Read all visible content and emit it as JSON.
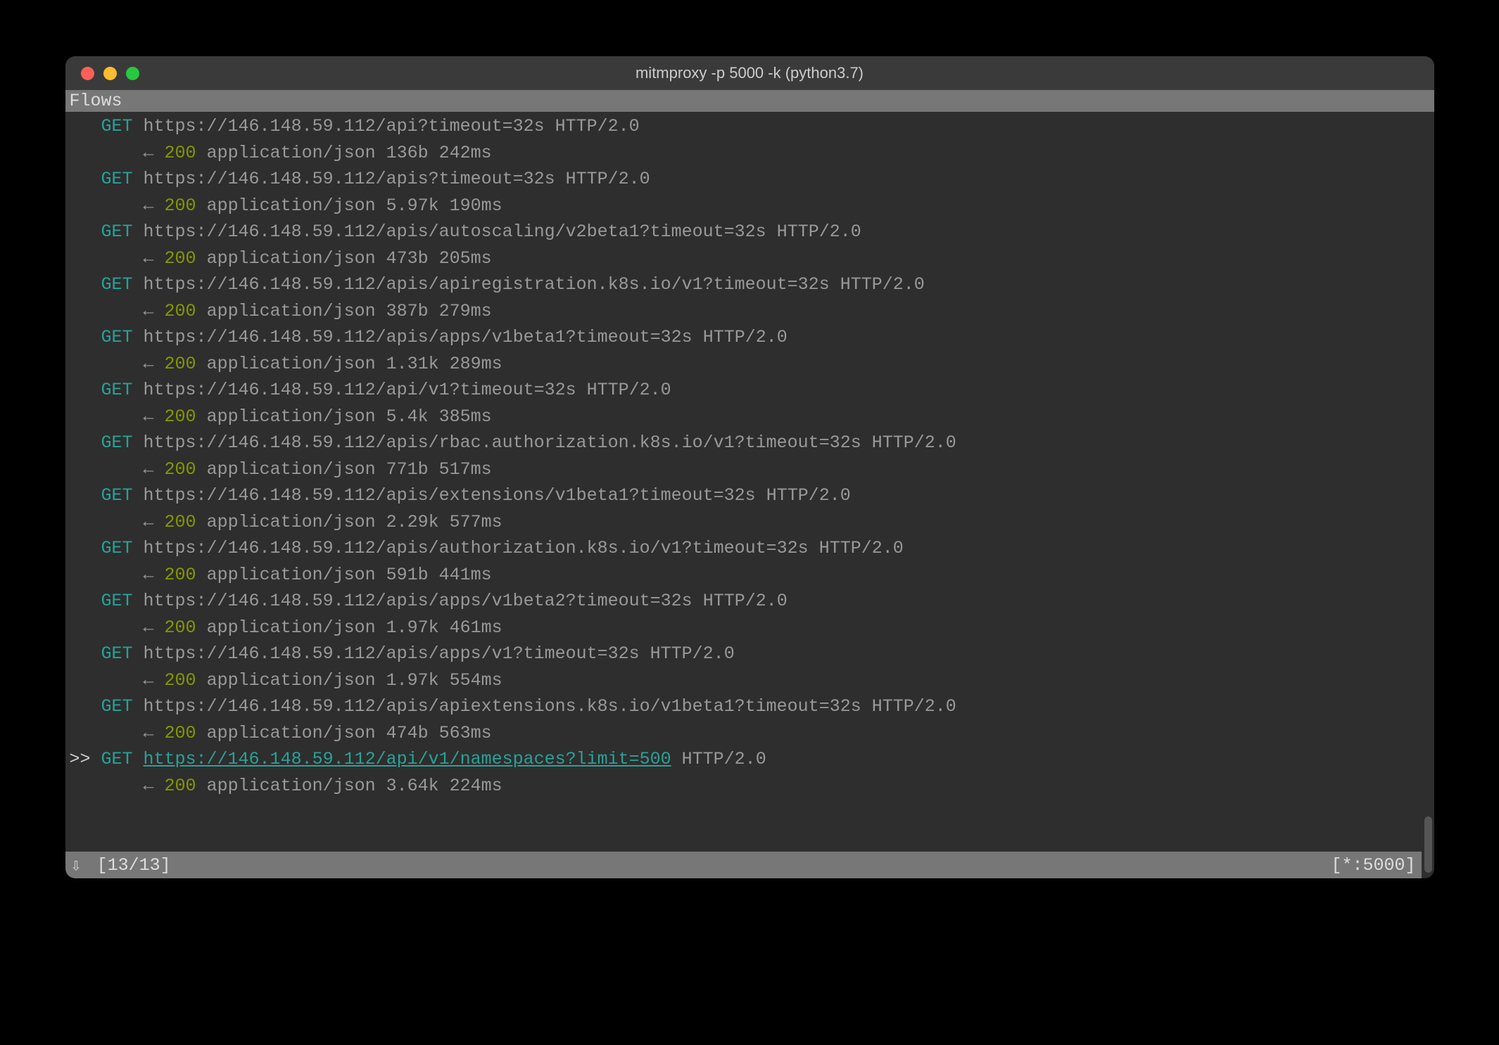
{
  "window": {
    "title": "mitmproxy -p 5000 -k (python3.7)"
  },
  "header": "Flows",
  "flows": [
    {
      "selected": false,
      "method": "GET",
      "url": "https://146.148.59.112/api?timeout=32s",
      "proto": "HTTP/2.0",
      "arrow": "←",
      "status": "200",
      "ctype": "application/json",
      "size": "136b",
      "time": "242ms"
    },
    {
      "selected": false,
      "method": "GET",
      "url": "https://146.148.59.112/apis?timeout=32s",
      "proto": "HTTP/2.0",
      "arrow": "←",
      "status": "200",
      "ctype": "application/json",
      "size": "5.97k",
      "time": "190ms"
    },
    {
      "selected": false,
      "method": "GET",
      "url": "https://146.148.59.112/apis/autoscaling/v2beta1?timeout=32s",
      "proto": "HTTP/2.0",
      "arrow": "←",
      "status": "200",
      "ctype": "application/json",
      "size": "473b",
      "time": "205ms"
    },
    {
      "selected": false,
      "method": "GET",
      "url": "https://146.148.59.112/apis/apiregistration.k8s.io/v1?timeout=32s",
      "proto": "HTTP/2.0",
      "arrow": "←",
      "status": "200",
      "ctype": "application/json",
      "size": "387b",
      "time": "279ms"
    },
    {
      "selected": false,
      "method": "GET",
      "url": "https://146.148.59.112/apis/apps/v1beta1?timeout=32s",
      "proto": "HTTP/2.0",
      "arrow": "←",
      "status": "200",
      "ctype": "application/json",
      "size": "1.31k",
      "time": "289ms"
    },
    {
      "selected": false,
      "method": "GET",
      "url": "https://146.148.59.112/api/v1?timeout=32s",
      "proto": "HTTP/2.0",
      "arrow": "←",
      "status": "200",
      "ctype": "application/json",
      "size": "5.4k",
      "time": "385ms"
    },
    {
      "selected": false,
      "method": "GET",
      "url": "https://146.148.59.112/apis/rbac.authorization.k8s.io/v1?timeout=32s",
      "proto": "HTTP/2.0",
      "arrow": "←",
      "status": "200",
      "ctype": "application/json",
      "size": "771b",
      "time": "517ms"
    },
    {
      "selected": false,
      "method": "GET",
      "url": "https://146.148.59.112/apis/extensions/v1beta1?timeout=32s",
      "proto": "HTTP/2.0",
      "arrow": "←",
      "status": "200",
      "ctype": "application/json",
      "size": "2.29k",
      "time": "577ms"
    },
    {
      "selected": false,
      "method": "GET",
      "url": "https://146.148.59.112/apis/authorization.k8s.io/v1?timeout=32s",
      "proto": "HTTP/2.0",
      "arrow": "←",
      "status": "200",
      "ctype": "application/json",
      "size": "591b",
      "time": "441ms"
    },
    {
      "selected": false,
      "method": "GET",
      "url": "https://146.148.59.112/apis/apps/v1beta2?timeout=32s",
      "proto": "HTTP/2.0",
      "arrow": "←",
      "status": "200",
      "ctype": "application/json",
      "size": "1.97k",
      "time": "461ms"
    },
    {
      "selected": false,
      "method": "GET",
      "url": "https://146.148.59.112/apis/apps/v1?timeout=32s",
      "proto": "HTTP/2.0",
      "arrow": "←",
      "status": "200",
      "ctype": "application/json",
      "size": "1.97k",
      "time": "554ms"
    },
    {
      "selected": false,
      "method": "GET",
      "url": "https://146.148.59.112/apis/apiextensions.k8s.io/v1beta1?timeout=32s",
      "proto": "HTTP/2.0",
      "arrow": "←",
      "status": "200",
      "ctype": "application/json",
      "size": "474b",
      "time": "563ms"
    },
    {
      "selected": true,
      "method": "GET",
      "url": "https://146.148.59.112/api/v1/namespaces?limit=500",
      "proto": "HTTP/2.0",
      "arrow": "←",
      "status": "200",
      "ctype": "application/json",
      "size": "3.64k",
      "time": "224ms"
    }
  ],
  "statusbar": {
    "scroll_icon": "⇩",
    "count": "[13/13]",
    "listen": "[*:5000]"
  }
}
